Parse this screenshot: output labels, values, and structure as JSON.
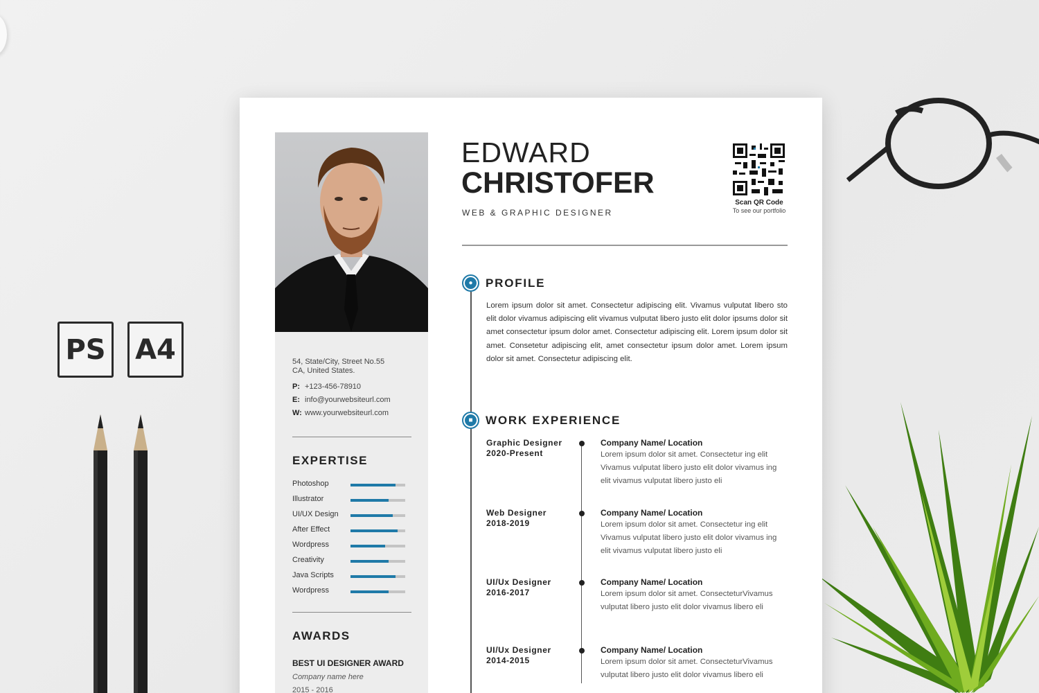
{
  "badges": [
    "PS",
    "A4"
  ],
  "resume": {
    "first_name": "EDWARD",
    "last_name": "CHRISTOFER",
    "role": "WEB & GRAPHIC DESIGNER",
    "qr": {
      "title": "Scan QR Code",
      "subtitle": "To see our portfolio"
    },
    "contact": {
      "address_line1": "54, State/City, Street No.55",
      "address_line2": "CA, United States.",
      "phone_key": "P:",
      "phone": "+123-456-78910",
      "email_key": "E:",
      "email": "info@yourwebsiteurl.com",
      "web_key": "W:",
      "web": "www.yourwebsiteurl.com"
    },
    "expertise": {
      "heading": "EXPERTISE",
      "skills": [
        {
          "name": "Photoshop",
          "level": 0.82
        },
        {
          "name": "Illustrator",
          "level": 0.7
        },
        {
          "name": "UI/UX Design",
          "level": 0.77
        },
        {
          "name": "After Effect",
          "level": 0.86
        },
        {
          "name": "Wordpress",
          "level": 0.63
        },
        {
          "name": "Creativity",
          "level": 0.7
        },
        {
          "name": "Java Scripts",
          "level": 0.82
        },
        {
          "name": "Wordpress",
          "level": 0.7
        }
      ]
    },
    "awards": {
      "heading": "AWARDS",
      "title": "BEST UI DESIGNER  AWARD",
      "company": "Company name here",
      "years": "2015 - 2016"
    },
    "profile": {
      "heading": "PROFILE",
      "text": "Lorem ipsum dolor sit amet. Consectetur adipiscing elit. Vivamus vulputat libero sto elit dolor vivamus adipiscing elit vivamus vulputat libero justo elit dolor ipsums dolor sit amet consectetur ipsum dolor amet. Consectetur adipiscing elit. Lorem ipsum dolor sit amet. Consetetur adipiscing elit, amet consectetur ipsum dolor amet. Lorem ipsum dolor sit amet. Consectetur adipiscing elit."
    },
    "work": {
      "heading": "WORK EXPERIENCE",
      "jobs": [
        {
          "title": "Graphic Designer",
          "years": "2020-Present",
          "company": "Company Name/ Location",
          "desc": "Lorem ipsum dolor sit amet. Consectetur ing elit Vivamus vulputat libero justo elit dolor vivamus ing elit vivamus vulputat libero justo eli"
        },
        {
          "title": "Web Designer",
          "years": "2018-2019",
          "company": "Company Name/ Location",
          "desc": "Lorem ipsum dolor sit amet. Consectetur ing elit Vivamus vulputat libero justo elit dolor vivamus ing elit vivamus vulputat libero justo eli"
        },
        {
          "title": "UI/Ux Designer",
          "years": "2016-2017",
          "company": "Company Name/ Location",
          "desc": "Lorem ipsum dolor sit amet. ConsecteturVivamus vulputat libero justo elit dolor vivamus libero eli"
        },
        {
          "title": "UI/Ux Designer",
          "years": "2014-2015",
          "company": "Company Name/ Location",
          "desc": "Lorem ipsum dolor sit amet. ConsecteturVivamus vulputat libero justo elit dolor vivamus libero eli"
        }
      ]
    }
  }
}
